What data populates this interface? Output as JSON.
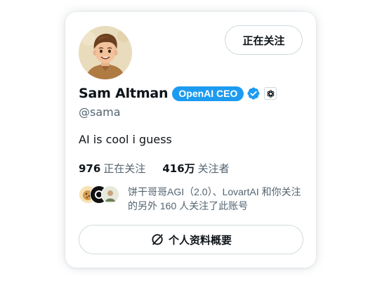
{
  "profile": {
    "display_name": "Sam Altman",
    "affiliation_badge": "OpenAI CEO",
    "handle": "@sama",
    "bio": "AI is cool i guess",
    "verified_icon": "verified-check-icon",
    "org_icon": "openai-logo-icon",
    "avatar": "profile-avatar-illustration"
  },
  "actions": {
    "follow_button": "正在关注",
    "profile_summary_button": "个人资料概要",
    "profile_summary_icon": "grok-slash-circle-icon"
  },
  "stats": {
    "following_count": "976",
    "following_label": "正在关注",
    "followers_count": "416万",
    "followers_label": "关注者"
  },
  "followers_you_know": {
    "text": "饼干哥哥AGI（2.0）、LovartAI 和你关注的另外 160 人关注了此账号"
  },
  "colors": {
    "accent_blue": "#1d9bf0",
    "secondary_text": "#536471",
    "primary_text": "#0f1419",
    "border": "#cfd9de"
  }
}
